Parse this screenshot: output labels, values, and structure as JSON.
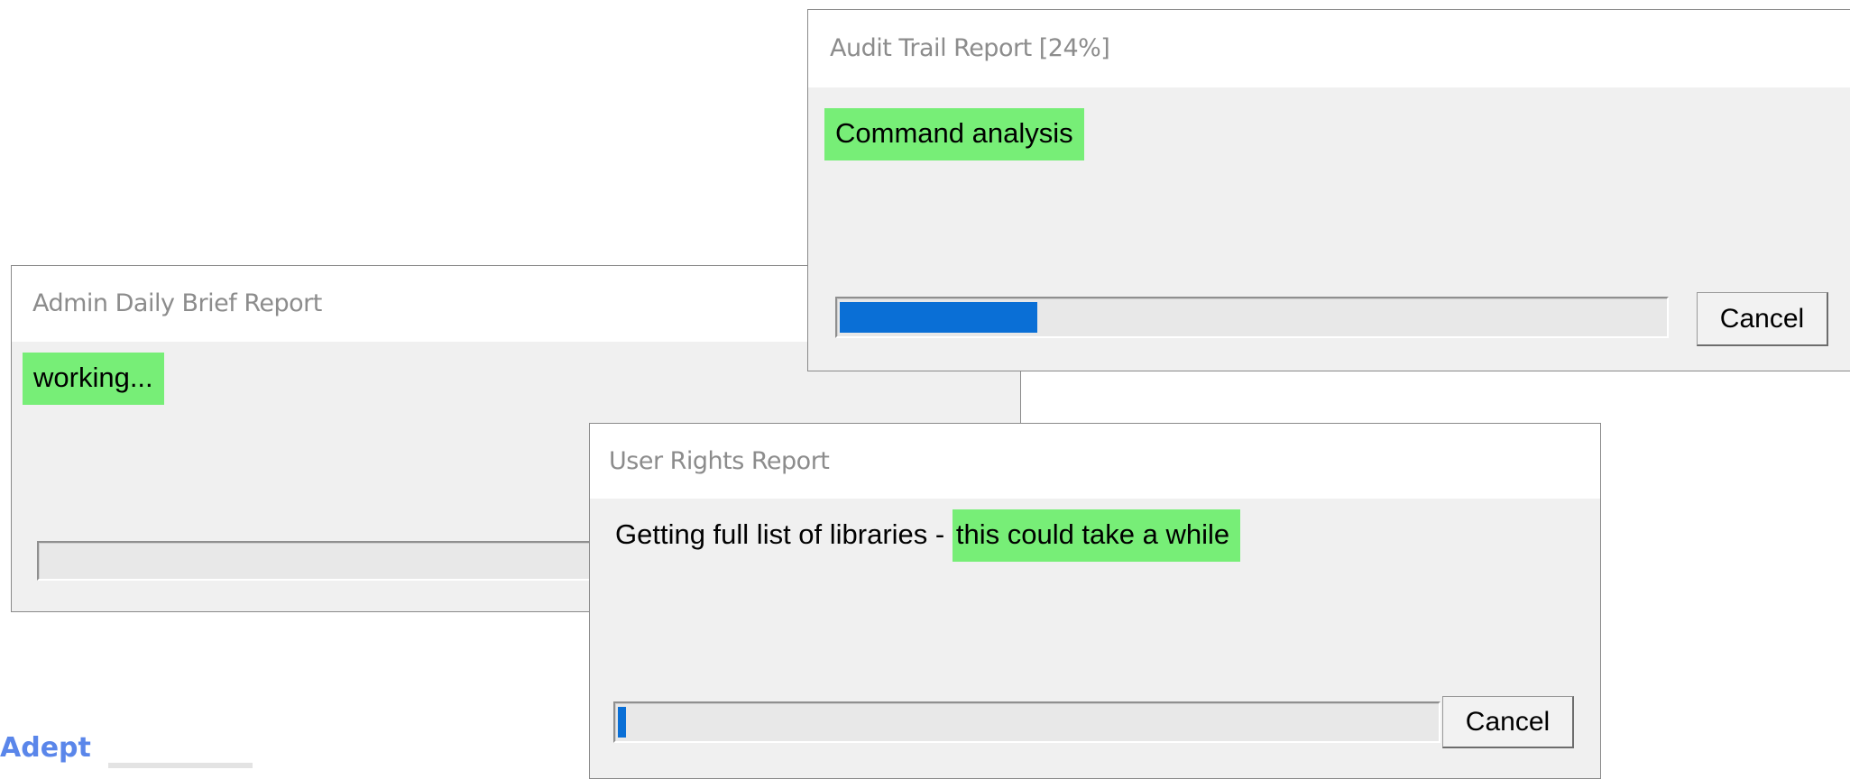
{
  "dialogs": {
    "audit": {
      "title": "Audit Trail Report [24%]",
      "message": "Command analysis",
      "progress": 0.24,
      "cancel_label": "Cancel"
    },
    "admin": {
      "title": "Admin Daily Brief Report",
      "message": "working...",
      "progress": 0
    },
    "rights": {
      "title": "User Rights Report",
      "message_prefix": "Getting full list of libraries - ",
      "message_highlight": "this could take a while",
      "progress": 0.01,
      "cancel_label": "Cancel"
    }
  },
  "brand": {
    "name": "Adept"
  },
  "colors": {
    "highlight": "#77ee77",
    "progress_fill": "#0a6fd6",
    "dialog_bg": "#f0f0f0",
    "title_text": "#8c8c8c",
    "brand": "#5a86ea"
  }
}
